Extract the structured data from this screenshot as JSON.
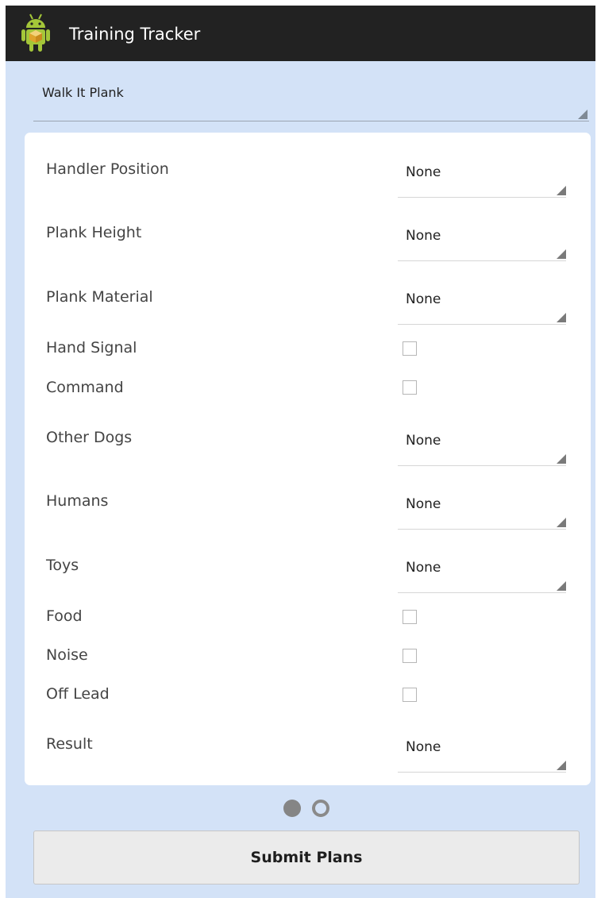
{
  "app": {
    "title": "Training Tracker",
    "icon": "android-robot-icon"
  },
  "exercise_spinner": {
    "value": "Walk It Plank"
  },
  "form": {
    "rows": [
      {
        "label": "Handler Position",
        "type": "dropdown",
        "value": "None"
      },
      {
        "label": "Plank Height",
        "type": "dropdown",
        "value": "None"
      },
      {
        "label": "Plank Material",
        "type": "dropdown",
        "value": "None"
      },
      {
        "label": "Hand Signal",
        "type": "checkbox",
        "checked": false
      },
      {
        "label": "Command",
        "type": "checkbox",
        "checked": false
      },
      {
        "label": "Other Dogs",
        "type": "dropdown",
        "value": "None"
      },
      {
        "label": "Humans",
        "type": "dropdown",
        "value": "None"
      },
      {
        "label": "Toys",
        "type": "dropdown",
        "value": "None"
      },
      {
        "label": "Food",
        "type": "checkbox",
        "checked": false
      },
      {
        "label": "Noise",
        "type": "checkbox",
        "checked": false
      },
      {
        "label": "Off Lead",
        "type": "checkbox",
        "checked": false
      },
      {
        "label": "Result",
        "type": "dropdown",
        "value": "None"
      }
    ]
  },
  "pager": {
    "total": 2,
    "current": 1
  },
  "submit_button": {
    "label": "Submit Plans"
  },
  "colors": {
    "action_bar": "#222222",
    "background": "#d3e2f7",
    "card": "#ffffff"
  }
}
